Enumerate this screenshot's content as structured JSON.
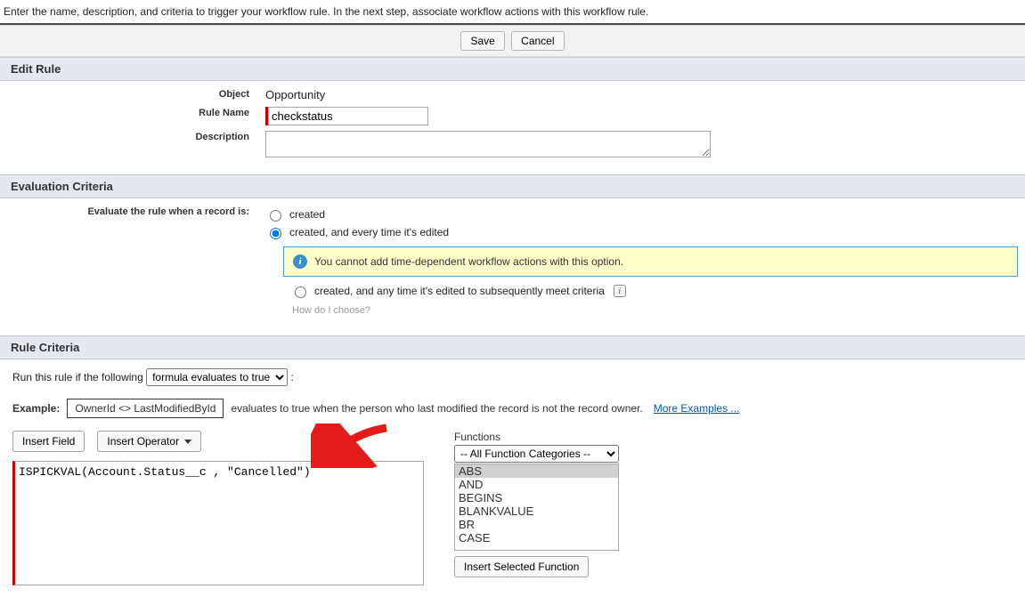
{
  "intro_text": "Enter the name, description, and criteria to trigger your workflow rule. In the next step, associate workflow actions with this workflow rule.",
  "buttons": {
    "save": "Save",
    "cancel": "Cancel"
  },
  "sections": {
    "edit_rule": "Edit Rule",
    "eval_criteria": "Evaluation Criteria",
    "rule_criteria": "Rule Criteria"
  },
  "edit_rule": {
    "object_label": "Object",
    "object_value": "Opportunity",
    "rule_name_label": "Rule Name",
    "rule_name_value": "checkstatus",
    "description_label": "Description",
    "description_value": ""
  },
  "eval": {
    "evaluate_label": "Evaluate the rule when a record is:",
    "opt_created": "created",
    "opt_edited": "created, and every time it's edited",
    "warning_text": "You cannot add time-dependent workflow actions with this option.",
    "opt_subsequent": "created, and any time it's edited to subsequently meet criteria",
    "how_choose": "How do I choose?"
  },
  "criteria": {
    "run_prefix": "Run this rule if the following",
    "dropdown_value": "formula evaluates to true",
    "example_label": "Example:",
    "example_formula": "OwnerId <> LastModifiedById",
    "example_text": "evaluates to true when the person who last modified the record is not the record owner.",
    "more_examples": "More Examples ...",
    "insert_field": "Insert Field",
    "insert_operator": "Insert Operator",
    "formula_value": "ISPICKVAL(Account.Status__c , \"Cancelled\")",
    "functions_label": "Functions",
    "functions_category": "-- All Function Categories --",
    "functions": [
      "ABS",
      "AND",
      "BEGINS",
      "BLANKVALUE",
      "BR",
      "CASE"
    ],
    "insert_selected": "Insert Selected Function"
  }
}
